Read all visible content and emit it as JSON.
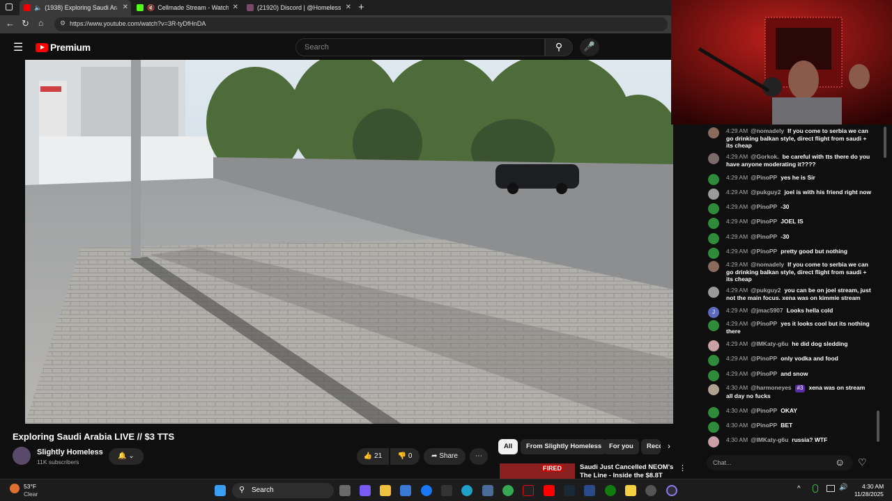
{
  "browser": {
    "tabs": [
      {
        "title": "(1938) Exploring Saudi Arabi",
        "active": true
      },
      {
        "title": "Cellmade Stream - Watch Li",
        "active": false
      },
      {
        "title": "(21920) Discord | @Homeless",
        "active": false
      }
    ],
    "url": "https://www.youtube.com/watch?v=3R-tyDfHnDA"
  },
  "youtube": {
    "logo": "Premium",
    "search_placeholder": "Search"
  },
  "video": {
    "title": "Exploring Saudi Arabia LIVE // $3 TTS",
    "channel": "Slightly Homeless",
    "subscribers": "11K subscribers",
    "likes": "21",
    "dislikes": "0",
    "share": "Share"
  },
  "chips": [
    "All",
    "From Slightly Homeless",
    "For you",
    "Reco"
  ],
  "recommended": {
    "title_line1": "Saudi Just Cancelled NEOM's",
    "title_line2": "The Line - Inside the $8.8T",
    "thumb_text": "FIRED"
  },
  "chat": {
    "messages": [
      {
        "time": "4:29 AM",
        "author": "@nomadely",
        "text": "If you come to serbia we can go drinking balkan style, direct flight from saudi + its cheap",
        "color": "#8a6a5a"
      },
      {
        "time": "4:29 AM",
        "author": "@Gorkok.",
        "text": "be careful with tts there do you have anyone moderating it????",
        "color": "#7a6a6a"
      },
      {
        "time": "4:29 AM",
        "author": "@PinoPP",
        "text": "yes he is Sir",
        "color": "#2e8b3a"
      },
      {
        "time": "4:29 AM",
        "author": "@pukguy2",
        "text": "joel is with his friend right now",
        "color": "#9a9a9a"
      },
      {
        "time": "4:29 AM",
        "author": "@PinoPP",
        "text": "-30",
        "color": "#2e8b3a"
      },
      {
        "time": "4:29 AM",
        "author": "@PinoPP",
        "text": "JOEL IS",
        "color": "#2e8b3a"
      },
      {
        "time": "4:29 AM",
        "author": "@PinoPP",
        "text": "-30",
        "color": "#2e8b3a"
      },
      {
        "time": "4:29 AM",
        "author": "@PinoPP",
        "text": "pretty good but nothing",
        "color": "#2e8b3a"
      },
      {
        "time": "4:29 AM",
        "author": "@nomadely",
        "text": "If you come to serbia we can go drinking balkan style, direct flight from saudi + its cheap",
        "color": "#8a6a5a"
      },
      {
        "time": "4:29 AM",
        "author": "@pukguy2",
        "text": "you can be on joel stream, just not the main focus. xena was on kimmie stream",
        "color": "#9a9a9a"
      },
      {
        "time": "4:29 AM",
        "author": "@jmac5907",
        "text": "Looks hella cold",
        "color": "#5c6bc0",
        "initial": "J"
      },
      {
        "time": "4:29 AM",
        "author": "@PinoPP",
        "text": "yes it looks cool but its nothing there",
        "color": "#2e8b3a"
      },
      {
        "time": "4:29 AM",
        "author": "@IMKaty-g6u",
        "text": "he did dog sledding",
        "color": "#c9a0a8"
      },
      {
        "time": "4:29 AM",
        "author": "@PinoPP",
        "text": "only vodka and food",
        "color": "#2e8b3a"
      },
      {
        "time": "4:29 AM",
        "author": "@PinoPP",
        "text": "and snow",
        "color": "#2e8b3a"
      },
      {
        "time": "4:30 AM",
        "author": "@harmoneyes",
        "badge": "#3",
        "text": "xena was on stream all day no fucks",
        "color": "#b0a090"
      },
      {
        "time": "4:30 AM",
        "author": "@PinoPP",
        "text": "OKAY",
        "color": "#2e8b3a"
      },
      {
        "time": "4:30 AM",
        "author": "@PinoPP",
        "text": "BET",
        "color": "#2e8b3a"
      },
      {
        "time": "4:30 AM",
        "author": "@IMKaty-g6u",
        "text": "russia? WTF",
        "color": "#c9a0a8"
      }
    ],
    "input_placeholder": "Chat..."
  },
  "taskbar": {
    "weather_temp": "53°F",
    "weather_desc": "Clear",
    "search": "Search",
    "time": "4:30 AM",
    "date": "11/28/2025"
  }
}
